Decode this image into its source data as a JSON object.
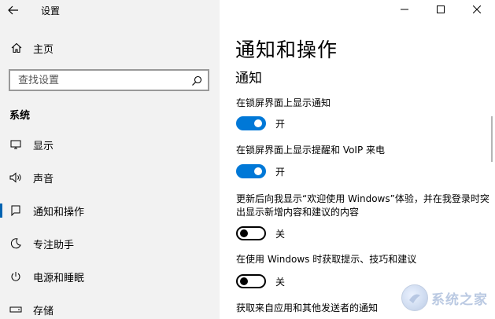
{
  "window": {
    "title": "设置",
    "controls": [
      "minimize",
      "maximize",
      "close"
    ]
  },
  "sidebar": {
    "home_label": "主页",
    "search": {
      "placeholder": "查找设置",
      "value": ""
    },
    "section_title": "系统",
    "items": [
      {
        "label": "显示",
        "icon": "monitor-icon",
        "active": false
      },
      {
        "label": "声音",
        "icon": "speaker-icon",
        "active": false
      },
      {
        "label": "通知和操作",
        "icon": "notification-icon",
        "active": true
      },
      {
        "label": "专注助手",
        "icon": "moon-icon",
        "active": false
      },
      {
        "label": "电源和睡眠",
        "icon": "power-icon",
        "active": false
      },
      {
        "label": "存储",
        "icon": "storage-icon",
        "active": false
      }
    ]
  },
  "main": {
    "title": "通知和操作",
    "section": "通知",
    "settings": [
      {
        "label": "在锁屏界面上显示通知",
        "state": "开",
        "on": true
      },
      {
        "label": "在锁屏界面上显示提醒和 VoIP 来电",
        "state": "开",
        "on": true
      },
      {
        "label": "更新后向我显示“欢迎使用 Windows”体验，并在我登录时突出显示新增内容和建议的内容",
        "state": "关",
        "on": false
      },
      {
        "label": "在使用 Windows 时获取提示、技巧和建议",
        "state": "关",
        "on": false
      }
    ],
    "truncated_label": "获取来自应用和其他发送者的通知"
  },
  "colors": {
    "accent": "#0078d7",
    "sidebar_bg": "#f2f2f2",
    "main_bg": "#ffffff"
  },
  "watermark": {
    "text": "系统之家"
  }
}
